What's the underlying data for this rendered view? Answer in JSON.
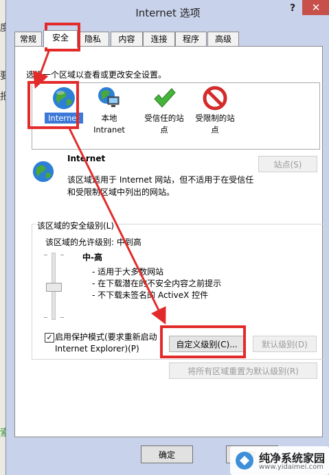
{
  "window": {
    "title": "Internet 选项",
    "help": "?",
    "close": "✕"
  },
  "background": {
    "chars": [
      "度",
      "要",
      "报",
      "索"
    ]
  },
  "tabs": [
    "常规",
    "安全",
    "隐私",
    "内容",
    "连接",
    "程序",
    "高级"
  ],
  "security": {
    "instruction": "选择一个区域以查看或更改安全设置。",
    "zones": [
      {
        "label": "Internet",
        "icon": "globe-icon",
        "selected": true
      },
      {
        "label": "本地\nIntranet",
        "icon": "intranet-icon"
      },
      {
        "label": "受信任的站\n点",
        "icon": "checkmark-icon"
      },
      {
        "label": "受限制的站\n点",
        "icon": "no-entry-icon"
      }
    ],
    "zone_title": "Internet",
    "zone_desc": "该区域适用于 Internet 网站，但不适用于在受信任\n和受限制区域中列出的网站。",
    "sites_button": "站点(S)",
    "level_group_label": "该区域的安全级别(L)",
    "allowed_level": "该区域的允许级别: 中到高",
    "level_name": "中-高",
    "level_bullets": [
      "- 适用于大多数网站",
      "- 在下载潜在的不安全内容之前提示",
      "- 不下载未签名的 ActiveX 控件"
    ],
    "protected_mode": "启用保护模式(要求重新启动\nInternet Explorer)(P)",
    "protected_checked": "✓",
    "custom_level_button": "自定义级别(C)...",
    "default_level_button": "默认级别(D)",
    "reset_all_button": "将所有区域重置为默认级别(R)"
  },
  "footer": {
    "ok_button": "确定",
    "cancel_button": "取"
  },
  "watermark": {
    "brand": "纯净系统家园",
    "url": "www.yidaimei.com"
  },
  "colors": {
    "annotation_red": "#e22a2a",
    "selection_blue": "#3c78d8"
  }
}
